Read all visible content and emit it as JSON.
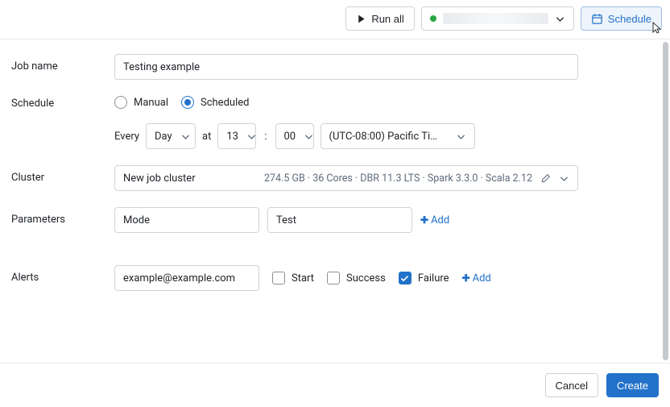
{
  "topbar": {
    "run_all": "Run all",
    "schedule": "Schedule"
  },
  "form": {
    "job_name_label": "Job name",
    "job_name_value": "Testing example",
    "schedule_label": "Schedule",
    "schedule_mode": {
      "manual": "Manual",
      "scheduled": "Scheduled",
      "selected": "scheduled"
    },
    "every_label": "Every",
    "every_unit": "Day",
    "at_label": "at",
    "hour": "13",
    "minute": "00",
    "timezone": "(UTC-08:00) Pacific Ti…",
    "cluster_label": "Cluster",
    "cluster_name": "New job cluster",
    "cluster_spec": "274.5 GB · 36 Cores · DBR 11.3 LTS · Spark 3.3.0 · Scala 2.12",
    "parameters_label": "Parameters",
    "param_key": "Mode",
    "param_value": "Test",
    "add_param": "Add",
    "alerts_label": "Alerts",
    "alert_email": "example@example.com",
    "alert_start": "Start",
    "alert_success": "Success",
    "alert_failure": "Failure",
    "add_alert": "Add"
  },
  "footer": {
    "cancel": "Cancel",
    "create": "Create"
  }
}
